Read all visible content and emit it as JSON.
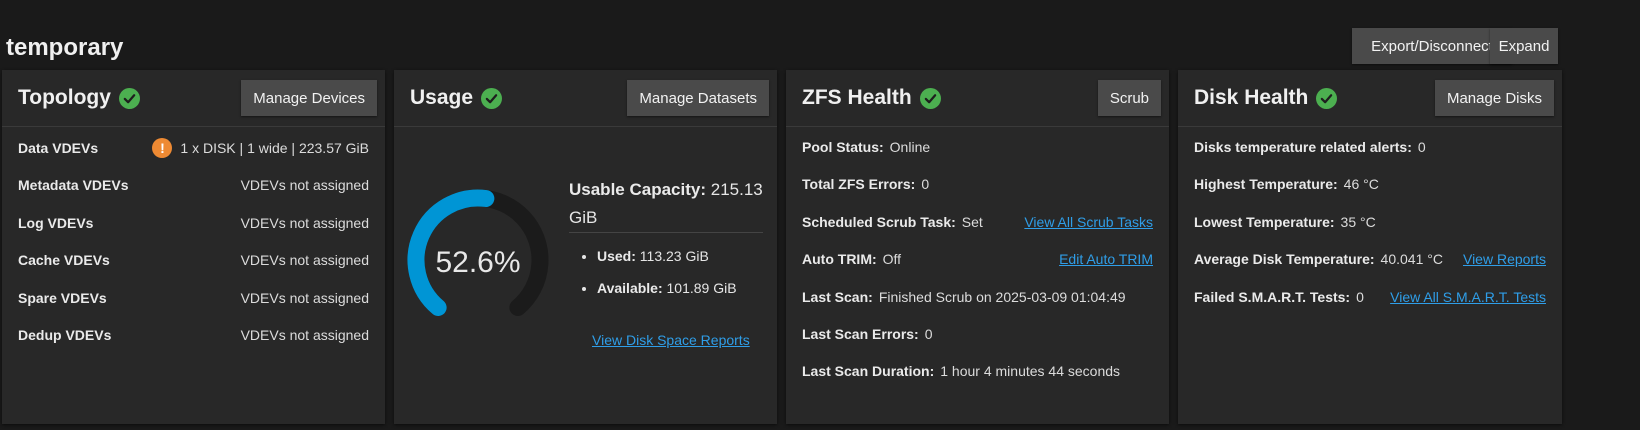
{
  "pool": {
    "name": "temporary",
    "export_label": "Export/Disconnect",
    "expand_label": "Expand"
  },
  "topology": {
    "title": "Topology",
    "button": "Manage Devices",
    "rows": [
      {
        "label": "Data VDEVs",
        "value": "1 x DISK | 1 wide | 223.57 GiB",
        "warning": "!"
      },
      {
        "label": "Metadata VDEVs",
        "value": "VDEVs not assigned"
      },
      {
        "label": "Log VDEVs",
        "value": "VDEVs not assigned"
      },
      {
        "label": "Cache VDEVs",
        "value": "VDEVs not assigned"
      },
      {
        "label": "Spare VDEVs",
        "value": "VDEVs not assigned"
      },
      {
        "label": "Dedup VDEVs",
        "value": "VDEVs not assigned"
      }
    ]
  },
  "usage": {
    "title": "Usage",
    "button": "Manage Datasets",
    "percent_text": "52.6%",
    "percent": 52.6,
    "capacity_label": "Usable Capacity:",
    "capacity_value": "215.13",
    "capacity_unit": "GiB",
    "used_label": "Used:",
    "used_value": "113.23 GiB",
    "available_label": "Available:",
    "available_value": "101.89 GiB",
    "link": "View Disk Space Reports",
    "gauge_color": "#0095d5",
    "track_color": "#1b1b1b"
  },
  "zfs": {
    "title": "ZFS Health",
    "button": "Scrub",
    "pool_status_label": "Pool Status:",
    "pool_status": "Online",
    "errors_label": "Total ZFS Errors:",
    "errors": "0",
    "scrub_task_label": "Scheduled Scrub Task:",
    "scrub_task": "Set",
    "scrub_link": "View All Scrub Tasks",
    "trim_label": "Auto TRIM:",
    "trim": "Off",
    "trim_link": "Edit Auto TRIM",
    "last_scan_label": "Last Scan:",
    "last_scan": "Finished Scrub on 2025-03-09 01:04:49",
    "last_scan_errors_label": "Last Scan Errors:",
    "last_scan_errors": "0",
    "duration_label": "Last Scan Duration:",
    "duration": "1 hour 4 minutes 44 seconds"
  },
  "disk": {
    "title": "Disk Health",
    "button": "Manage Disks",
    "alerts_label": "Disks temperature related alerts:",
    "alerts": "0",
    "highest_label": "Highest Temperature:",
    "highest": "46 °C",
    "lowest_label": "Lowest Temperature:",
    "lowest": "35 °C",
    "average_label": "Average Disk Temperature:",
    "average": "40.041 °C",
    "reports_link": "View Reports",
    "smart_label": "Failed S.M.A.R.T. Tests:",
    "smart": "0",
    "smart_link": "View All S.M.A.R.T. Tests"
  },
  "colors": {
    "ok": "#4caf50",
    "warning": "#ee8a33",
    "link": "#2f9ee8"
  },
  "icons": {
    "status_ok": "check-circle-icon",
    "warning": "alert-circle-icon"
  }
}
